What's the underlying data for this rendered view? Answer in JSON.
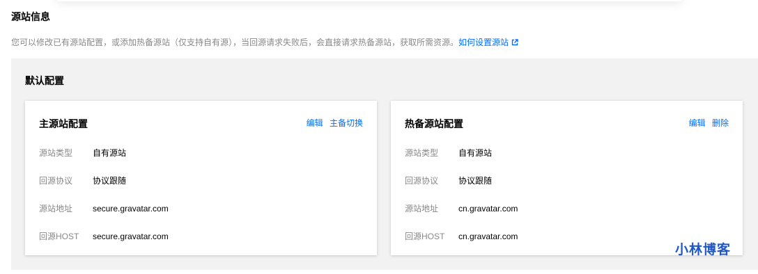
{
  "section": {
    "title": "源站信息",
    "description": "您可以修改已有源站配置，或添加热备源站（仅支持自有源），当回源请求失败后，会直接请求热备源站，获取所需资源。",
    "help_link": "如何设置源站"
  },
  "panel": {
    "title": "默认配置"
  },
  "cards": [
    {
      "title": "主源站配置",
      "actions": [
        "编辑",
        "主备切换"
      ],
      "rows": [
        {
          "label": "源站类型",
          "value": "自有源站"
        },
        {
          "label": "回源协议",
          "value": "协议跟随"
        },
        {
          "label": "源站地址",
          "value": "secure.gravatar.com"
        },
        {
          "label": "回源HOST",
          "value": "secure.gravatar.com"
        }
      ]
    },
    {
      "title": "热备源站配置",
      "actions": [
        "编辑",
        "删除"
      ],
      "rows": [
        {
          "label": "源站类型",
          "value": "自有源站"
        },
        {
          "label": "回源协议",
          "value": "协议跟随"
        },
        {
          "label": "源站地址",
          "value": "cn.gravatar.com"
        },
        {
          "label": "回源HOST",
          "value": "cn.gravatar.com"
        }
      ]
    }
  ],
  "watermark": "小林博客",
  "colors": {
    "link": "#006eff",
    "panel_bg": "#f2f2f2",
    "label": "#888888",
    "watermark": "#1f58c6"
  }
}
